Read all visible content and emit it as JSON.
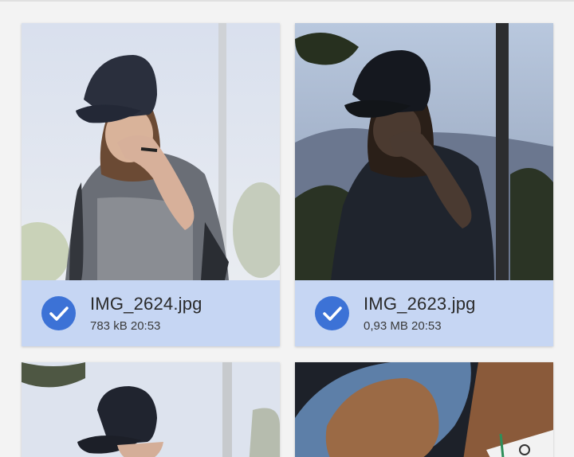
{
  "colors": {
    "selected_background": "#c6d6f3",
    "check_circle": "#3c72d6",
    "page_background": "#f3f3f3"
  },
  "files": [
    {
      "name": "IMG_2624.jpg",
      "size_time": "783 kB  20:53",
      "selected": true,
      "check_icon": "check-circle-icon"
    },
    {
      "name": "IMG_2623.jpg",
      "size_time": "0,93 MB  20:53",
      "selected": true,
      "check_icon": "check-circle-icon"
    },
    {
      "selected": false
    },
    {
      "selected": false
    }
  ]
}
